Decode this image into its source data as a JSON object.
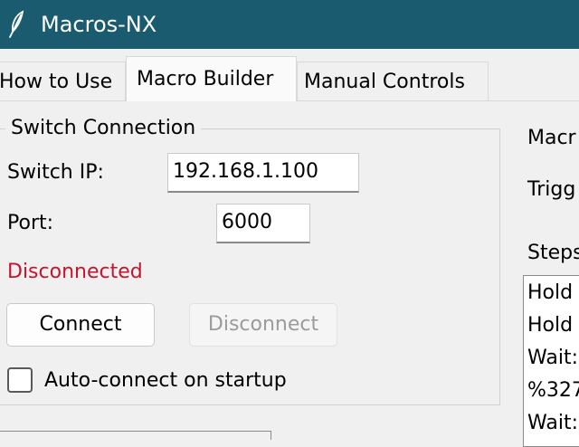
{
  "window": {
    "title": "Macros-NX",
    "icon": "feather-icon"
  },
  "tabs": [
    {
      "label": "How to Use",
      "active": false
    },
    {
      "label": "Macro Builder",
      "active": true
    },
    {
      "label": "Manual Controls",
      "active": false
    }
  ],
  "connection": {
    "group_title": "Switch Connection",
    "ip_label": "Switch IP:",
    "ip_value": "192.168.1.100",
    "port_label": "Port:",
    "port_value": "6000",
    "status": "Disconnected",
    "status_color": "#c6142d",
    "connect_label": "Connect",
    "disconnect_label": "Disconnect",
    "autoconnect_label": "Auto-connect on startup",
    "autoconnect_checked": false
  },
  "right_panel": {
    "macro_label": "Macr",
    "trigger_label": "Trigg",
    "steps_label": "Steps",
    "steps": [
      "Hold",
      "Hold",
      "Wait:",
      "%327",
      "Wait:"
    ]
  },
  "colors": {
    "titlebar": "#1b5b70",
    "background": "#f0f0f0"
  }
}
